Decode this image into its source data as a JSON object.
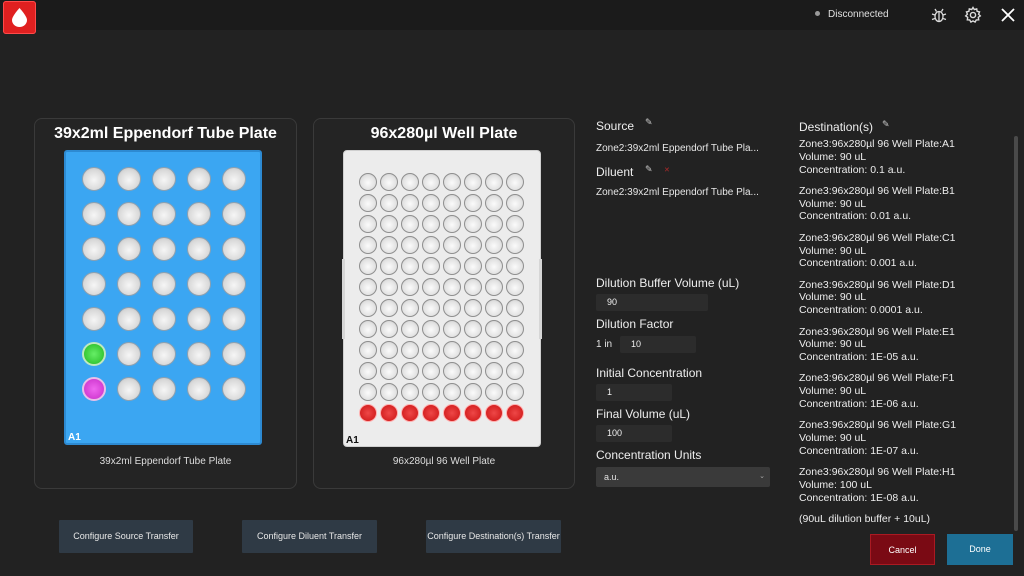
{
  "status": {
    "text": "Disconnected"
  },
  "icons": {
    "app": "blood-drop-icon",
    "debug": "bug-icon",
    "settings": "gear-icon",
    "close": "close-icon"
  },
  "source_plate": {
    "title": "39x2ml Eppendorf Tube Plate",
    "caption": "39x2ml Eppendorf Tube Plate",
    "corner_label": "A1",
    "rows": 7,
    "cols": 5,
    "tube_count": 39,
    "highlight_green": "row 6, col 1",
    "highlight_magenta": "row 7, col 1"
  },
  "dest_plate": {
    "title": "96x280µl Well Plate",
    "caption": "96x280µl 96 Well Plate",
    "corner_label": "A1",
    "rows": 12,
    "cols": 8,
    "highlighted_row": "last row (red)"
  },
  "form": {
    "source_label": "Source",
    "source_value": "Zone2:39x2ml Eppendorf Tube Pla...",
    "diluent_label": "Diluent",
    "diluent_value": "Zone2:39x2ml Eppendorf Tube Pla...",
    "buffer_label": "Dilution Buffer Volume (uL)",
    "buffer_value": "90",
    "factor_label": "Dilution Factor",
    "factor_prefix": "1 in",
    "factor_value": "10",
    "initial_label": "Initial Concentration",
    "initial_value": "1",
    "final_label": "Final Volume (uL)",
    "final_value": "100",
    "units_label": "Concentration Units",
    "units_value": "a.u."
  },
  "destinations": {
    "label": "Destination(s)",
    "items": [
      {
        "well": "Zone3:96x280µl 96 Well Plate:A1",
        "volume": "Volume: 90 uL",
        "conc": "Concentration: 0.1 a.u."
      },
      {
        "well": "Zone3:96x280µl 96 Well Plate:B1",
        "volume": "Volume: 90 uL",
        "conc": "Concentration: 0.01 a.u."
      },
      {
        "well": "Zone3:96x280µl 96 Well Plate:C1",
        "volume": "Volume: 90 uL",
        "conc": "Concentration: 0.001 a.u."
      },
      {
        "well": "Zone3:96x280µl 96 Well Plate:D1",
        "volume": "Volume: 90 uL",
        "conc": "Concentration: 0.0001 a.u."
      },
      {
        "well": "Zone3:96x280µl 96 Well Plate:E1",
        "volume": "Volume: 90 uL",
        "conc": "Concentration: 1E-05 a.u."
      },
      {
        "well": "Zone3:96x280µl 96 Well Plate:F1",
        "volume": "Volume: 90 uL",
        "conc": "Concentration: 1E-06 a.u."
      },
      {
        "well": "Zone3:96x280µl 96 Well Plate:G1",
        "volume": "Volume: 90 uL",
        "conc": "Concentration: 1E-07 a.u."
      },
      {
        "well": "Zone3:96x280µl 96 Well Plate:H1",
        "volume": "Volume: 100 uL",
        "conc": "Concentration: 1E-08 a.u."
      }
    ],
    "footer": "(90uL dilution buffer + 10uL)"
  },
  "buttons": {
    "configure_source": "Configure Source Transfer",
    "configure_diluent": "Configure Diluent Transfer",
    "configure_destinations": "Configure Destination(s) Transfer",
    "cancel": "Cancel",
    "done": "Done"
  }
}
